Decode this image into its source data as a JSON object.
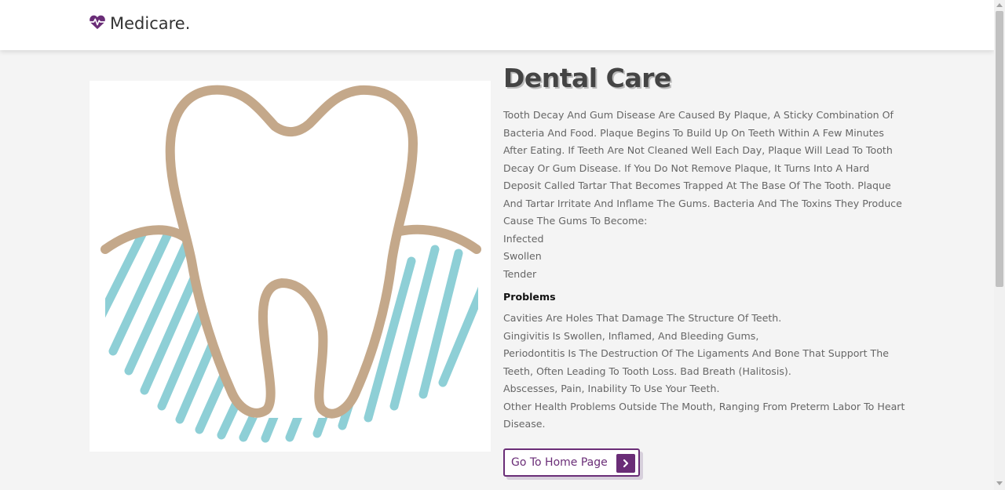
{
  "header": {
    "brand": "Medicare.",
    "logo_icon": "heartbeat-icon",
    "accent_color": "#6a2d77"
  },
  "hero": {
    "icon": "tooth-icon",
    "tooth_color": "#c4a88a",
    "stripe_color": "#8ecfd6"
  },
  "main": {
    "title": "Dental Care",
    "description": "Tooth Decay And Gum Disease Are Caused By Plaque, A Sticky Combination Of Bacteria And Food. Plaque Begins To Build Up On Teeth Within A Few Minutes After Eating. If Teeth Are Not Cleaned Well Each Day, Plaque Will Lead To Tooth Decay Or Gum Disease. If You Do Not Remove Plaque, It Turns Into A Hard Deposit Called Tartar That Becomes Trapped At The Base Of The Tooth. Plaque And Tartar Irritate And Inflame The Gums. Bacteria And The Toxins They Produce Cause The Gums To Become:",
    "gum_states": [
      "Infected",
      "Swollen",
      "Tender"
    ],
    "problems_title": "Problems",
    "problems": [
      "Cavities Are Holes That Damage The Structure Of Teeth.",
      "Gingivitis Is Swollen, Inflamed, And Bleeding Gums,",
      "Periodontitis Is The Destruction Of The Ligaments And Bone That Support The Teeth, Often Leading To Tooth Loss. Bad Breath (Halitosis).",
      "Abscesses, Pain, Inability To Use Your Teeth.",
      "Other Health Problems Outside The Mouth, Ranging From Preterm Labor To Heart Disease."
    ],
    "home_button": {
      "label": "Go To Home Page",
      "icon": "chevron-right-icon"
    }
  }
}
